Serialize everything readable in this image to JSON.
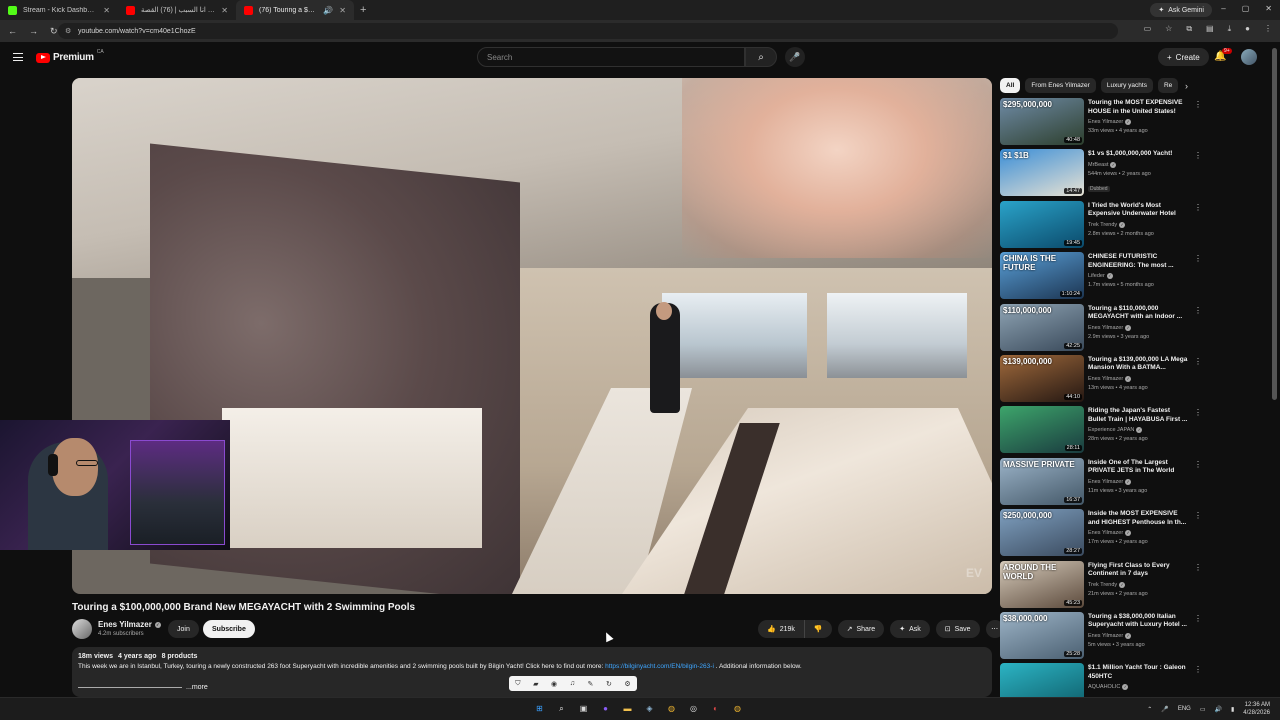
{
  "browser": {
    "tabs": [
      {
        "label": "Stream - Kick Dashboard",
        "color": "#53fc18"
      },
      {
        "label": "هل انا السبب | (76) القصة",
        "color": "#ff0000"
      },
      {
        "label": "(76) Touring a $100,000,000",
        "color": "#ff0000"
      }
    ],
    "new_tab": "+",
    "ask_gemini": "Ask Gemini",
    "url": "youtube.com/watch?v=cm40e1ChozE"
  },
  "yt_header": {
    "brand": "Premium",
    "region": "CA",
    "search_placeholder": "Search",
    "create_label": "Create",
    "notification_count": "9+"
  },
  "video": {
    "title": "Touring a $100,000,000 Brand New MEGAYACHT with 2 Swimming Pools",
    "watermark": "EV",
    "channel": "Enes Yilmazer",
    "subscribers": "4.2m subscribers",
    "join_label": "Join",
    "subscribe_label": "Subscribe",
    "likes": "219k",
    "share_label": "Share",
    "ask_label": "Ask",
    "save_label": "Save",
    "views": "18m views",
    "age": "4 years ago",
    "products": "8 products",
    "description_pre": "This week we are in Istanbul, Turkey, touring a newly constructed 263 foot Superyacht with incredible amenities and 2 swimming pools built by Bilgin Yacht! Click here to find out more: ",
    "description_link": "https://bilginyacht.com/EN/bilgin-263-i",
    "description_post": " . Additional information below.",
    "more_label": "...more"
  },
  "chips": [
    "All",
    "From Enes Yilmazer",
    "Luxury yachts",
    "Re"
  ],
  "recommendations": [
    {
      "title": "Touring the MOST EXPENSIVE HOUSE in the United States!",
      "channel": "Enes Yilmazer",
      "stats": "33m views • 4 years ago",
      "price": "$295,000,000",
      "duration": "40:48",
      "color1": "#6f8ba6",
      "color2": "#2d3f2d"
    },
    {
      "title": "$1 vs $1,000,000,000 Yacht!",
      "channel": "MrBeast",
      "stats": "544m views • 2 years ago",
      "price": "$1  $1B",
      "duration": "14:47",
      "badge": "Dubbed",
      "color1": "#3b8ed6",
      "color2": "#e8e2d4"
    },
    {
      "title": "I Tried the World's Most Expensive Underwater Hotel",
      "channel": "Trek Trendy",
      "stats": "2.8m views • 2 months ago",
      "price": "",
      "duration": "19:45",
      "color1": "#2aa3c9",
      "color2": "#0b4a6b"
    },
    {
      "title": "CHINESE FUTURISTIC ENGINEERING: The most ...",
      "channel": "Lifeder",
      "stats": "1.7m views • 5 months ago",
      "price": "CHINA IS THE FUTURE",
      "duration": "1:10:24",
      "color1": "#5aa0d8",
      "color2": "#1c3552"
    },
    {
      "title": "Touring a $110,000,000 MEGAYACHT with an Indoor ...",
      "channel": "Enes Yilmazer",
      "stats": "2.9m views • 3 years ago",
      "price": "$110,000,000",
      "duration": "42:25",
      "color1": "#8fa4b4",
      "color2": "#39495a"
    },
    {
      "title": "Touring a $139,000,000 LA Mega Mansion With a BATMA...",
      "channel": "Enes Yilmazer",
      "stats": "13m views • 4 years ago",
      "price": "$139,000,000",
      "duration": "44:10",
      "color1": "#a06a3c",
      "color2": "#241712"
    },
    {
      "title": "Riding the Japan's Fastest Bullet Train | HAYABUSA First ...",
      "channel": "Experience JAPAN",
      "stats": "28m views • 2 years ago",
      "price": "",
      "duration": "28:11",
      "color1": "#3da56b",
      "color2": "#1a3b3f"
    },
    {
      "title": "Inside One of The Largest PRIVATE JETS in The World",
      "channel": "Enes Yilmazer",
      "stats": "11m views • 3 years ago",
      "price": "MASSIVE PRIVATE",
      "duration": "16:37",
      "color1": "#9bb3c8",
      "color2": "#445868"
    },
    {
      "title": "Inside the MOST EXPENSIVE and HIGHEST Penthouse In th...",
      "channel": "Enes Yilmazer",
      "stats": "17m views • 2 years ago",
      "price": "$250,000,000",
      "duration": "28:27",
      "color1": "#7fa0c0",
      "color2": "#3b4b5f"
    },
    {
      "title": "Flying First Class to Every Continent in 7 days",
      "channel": "Trek Trendy",
      "stats": "21m views • 2 years ago",
      "price": "AROUND THE WORLD",
      "duration": "45:23",
      "color1": "#d6cbbb",
      "color2": "#5c4a3c"
    },
    {
      "title": "Touring a $38,000,000 Italian Superyacht with Luxury Hotel ...",
      "channel": "Enes Yilmazer",
      "stats": "5m views • 3 years ago",
      "price": "$38,000,000",
      "duration": "25:28",
      "color1": "#9db4c7",
      "color2": "#4b6072"
    },
    {
      "title": "$1.1 Million Yacht Tour : Galeon 450HTC",
      "channel": "AQUAHOLIC",
      "stats": "",
      "price": "",
      "duration": "",
      "color1": "#2cb4c4",
      "color2": "#0e5c68"
    }
  ],
  "taskbar": {
    "language": "ENG",
    "time": "12:36 AM",
    "date": "4/28/2026"
  }
}
